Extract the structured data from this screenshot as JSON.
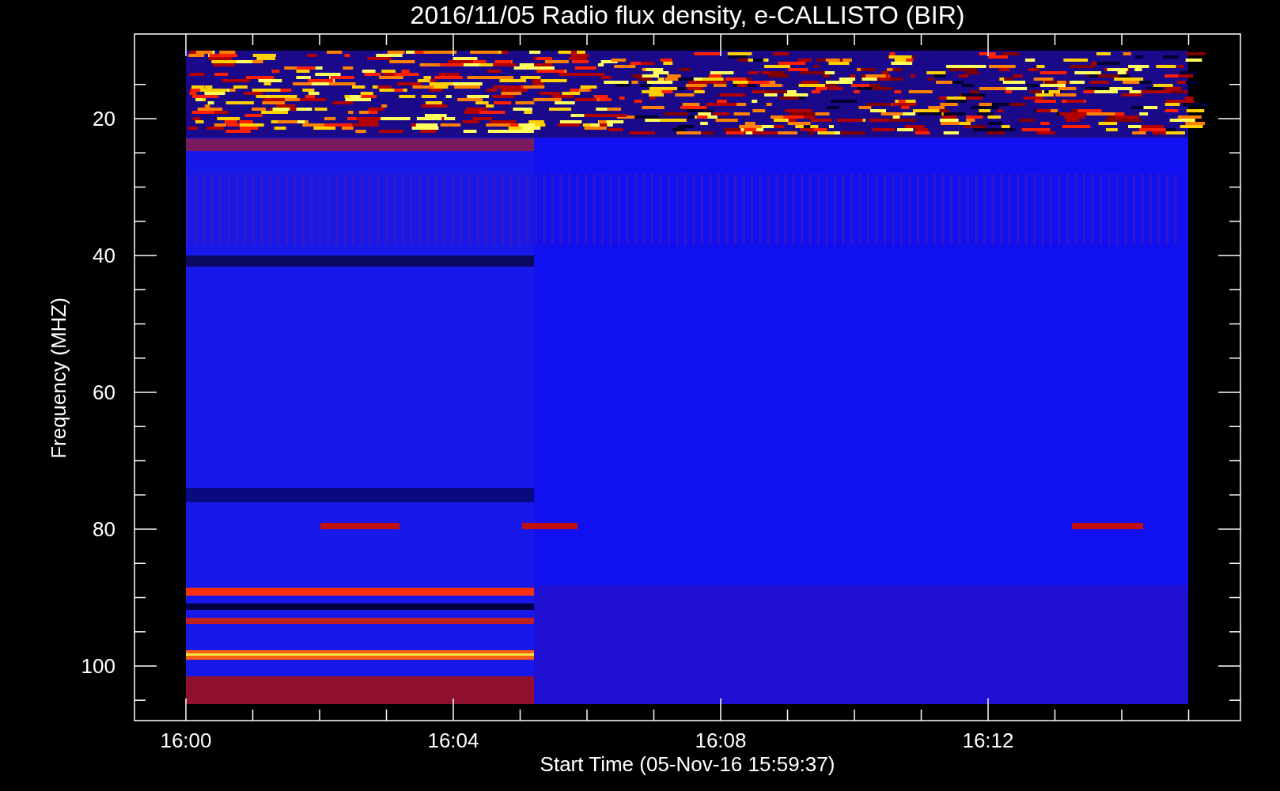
{
  "title": "2016/11/05  Radio flux density, e-CALLISTO (BIR)",
  "ylabel": "Frequency (MHZ)",
  "xlabel": "Start Time (05-Nov-16 15:59:37)",
  "yticks": [
    "20",
    "40",
    "60",
    "80",
    "100"
  ],
  "xticks": [
    "16:00",
    "16:04",
    "16:08",
    "16:12"
  ]
}
